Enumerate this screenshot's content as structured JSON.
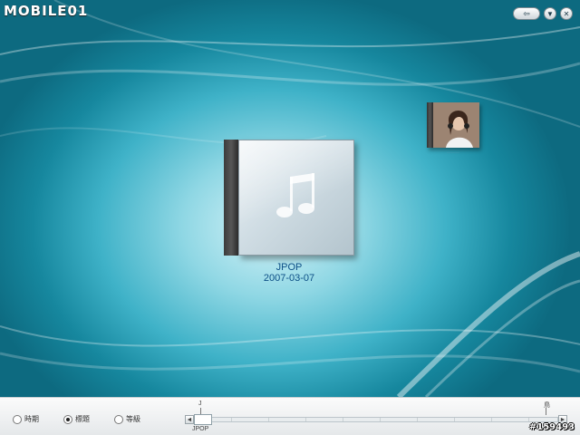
{
  "app": {
    "logo_text": "MOBILE01"
  },
  "window_controls": {
    "back_icon": "back-arrow-icon",
    "menu_icon": "chevron-down-icon",
    "close_icon": "close-icon"
  },
  "main_album": {
    "title": "JPOP",
    "date": "2007-03-07",
    "cover_icon": "music-note-icon"
  },
  "side_album": {
    "caption": "·······"
  },
  "bottom_bar": {
    "sort_options": [
      {
        "label": "時期",
        "selected": false
      },
      {
        "label": "標題",
        "selected": true
      },
      {
        "label": "等級",
        "selected": false
      }
    ],
    "timeline": {
      "start_marker": "J",
      "end_marker": "鳥",
      "thumb_label": "JPOP",
      "left_arrow": "◄",
      "right_arrow": "►"
    }
  },
  "watermark": "#159493"
}
